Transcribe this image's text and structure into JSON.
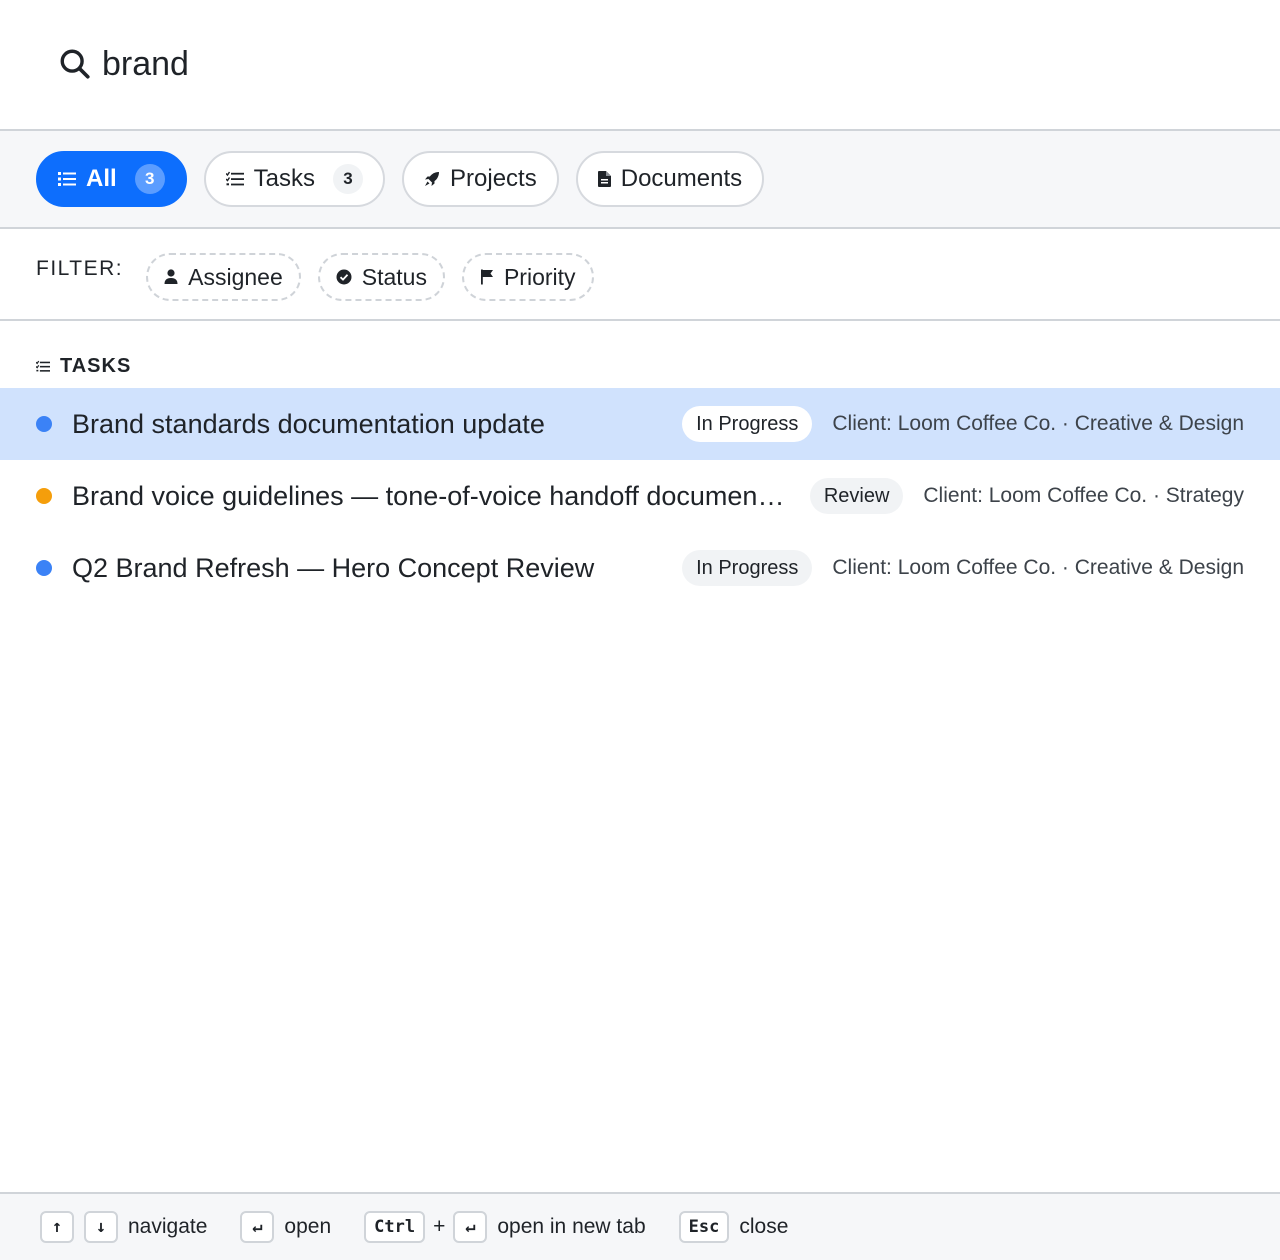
{
  "search": {
    "query": "brand",
    "icon": "search-icon"
  },
  "tabs": [
    {
      "label": "All",
      "count": "3",
      "icon": "list-icon",
      "active": true
    },
    {
      "label": "Tasks",
      "count": "3",
      "icon": "checklist-icon",
      "active": false
    },
    {
      "label": "Projects",
      "icon": "rocket-icon",
      "active": false
    },
    {
      "label": "Documents",
      "icon": "document-icon",
      "active": false
    }
  ],
  "filters": {
    "label": "FILTER:",
    "chips": [
      {
        "label": "Assignee",
        "icon": "user-icon"
      },
      {
        "label": "Status",
        "icon": "check-circle-icon"
      },
      {
        "label": "Priority",
        "icon": "flag-icon"
      }
    ]
  },
  "section": {
    "title": "TASKS",
    "icon": "checklist-icon"
  },
  "results": [
    {
      "title": "Brand standards documentation update",
      "status": "In Progress",
      "meta": "Client: Loom Coffee Co. · Creative & Design",
      "dot_color": "#3b82f6",
      "selected": true
    },
    {
      "title": "Brand voice guidelines — tone-of-voice handoff document for the client team",
      "status": "Review",
      "meta": "Client: Loom Coffee Co. · Strategy",
      "dot_color": "#f59e0b",
      "selected": false
    },
    {
      "title": "Q2 Brand Refresh — Hero Concept Review",
      "status": "In Progress",
      "meta": "Client: Loom Coffee Co. · Creative & Design",
      "dot_color": "#3b82f6",
      "selected": false
    }
  ],
  "footer": {
    "navigate_up_key": "↑",
    "navigate_down_key": "↓",
    "navigate_label": "navigate",
    "open_key": "↵",
    "open_label": "open",
    "ctrl_key": "Ctrl",
    "plus": "+",
    "newtab_enter_key": "↵",
    "newtab_label": "open in new tab",
    "esc_key": "Esc",
    "close_label": "close"
  },
  "colors": {
    "accent": "#0d6efd",
    "selected_row": "#d0e2fd"
  }
}
